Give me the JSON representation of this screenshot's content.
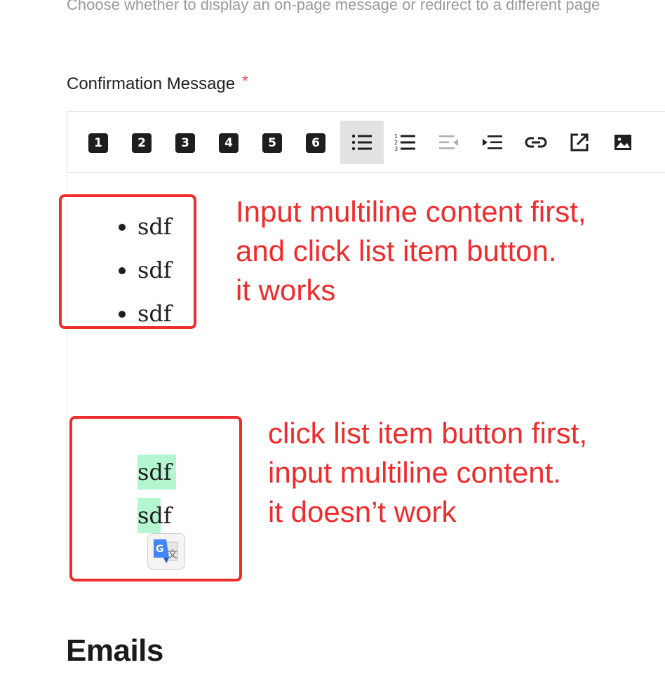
{
  "help_text": "Choose whether to display an on-page message or redirect to a different page",
  "field": {
    "label": "Confirmation Message",
    "required_mark": "*"
  },
  "toolbar": {
    "headings": [
      "1",
      "2",
      "3",
      "4",
      "5",
      "6"
    ],
    "icons": [
      "bulleted-list-icon",
      "numbered-list-icon",
      "outdent-icon",
      "indent-icon",
      "link-icon",
      "external-link-icon",
      "image-icon"
    ],
    "active": "bulleted-list-icon"
  },
  "editor": {
    "list_items": [
      "sdf",
      "sdf",
      "sdf"
    ],
    "plain_lines": [
      "sdf",
      "sdf"
    ],
    "highlight_color": "#b3f6d0"
  },
  "annotations": {
    "works": [
      "Input multiline content first,",
      "and click list item button.",
      "it works"
    ],
    "broken": [
      "click list item button first,",
      "input multiline content.",
      "it doesn’t work"
    ],
    "color": "#ee2c2c"
  },
  "section": {
    "title": "Emails"
  }
}
